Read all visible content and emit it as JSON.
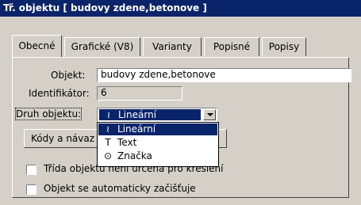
{
  "window": {
    "title": "Tř. objektu [ budovy zdene,betonove ]"
  },
  "tabs": [
    {
      "label": "Obecné",
      "active": true
    },
    {
      "label": "Grafické (V8)",
      "active": false
    },
    {
      "label": "Varianty",
      "active": false
    },
    {
      "label": "Popisné",
      "active": false
    },
    {
      "label": "Popisy",
      "active": false
    }
  ],
  "form": {
    "object_label": "Objekt:",
    "object_value": "budovy zdene,betonove",
    "id_label": "Identifikátor:",
    "id_value": "6",
    "kind_label": "Druh objektu:",
    "kind_selected_icon": "≀",
    "kind_selected": "Lineární",
    "codes_button": "Kódy a návaz",
    "checkbox1_label": "Třída objekt",
    "checkbox1_label_tail": "u není určena pro kreslení",
    "checkbox1_checked": false,
    "checkbox2_label": "Objekt se automaticky začišťuje",
    "checkbox2_checked": false
  },
  "dropdown_options": [
    {
      "icon": "≀",
      "label": "Lineární",
      "selected": true
    },
    {
      "icon": "T",
      "label": "Text",
      "selected": false
    },
    {
      "icon": "⊙",
      "label": "Značka",
      "selected": false
    }
  ],
  "colors": {
    "face": "#d4d0c8",
    "title_bg": "#0a246a",
    "highlight": "#0a246a"
  }
}
